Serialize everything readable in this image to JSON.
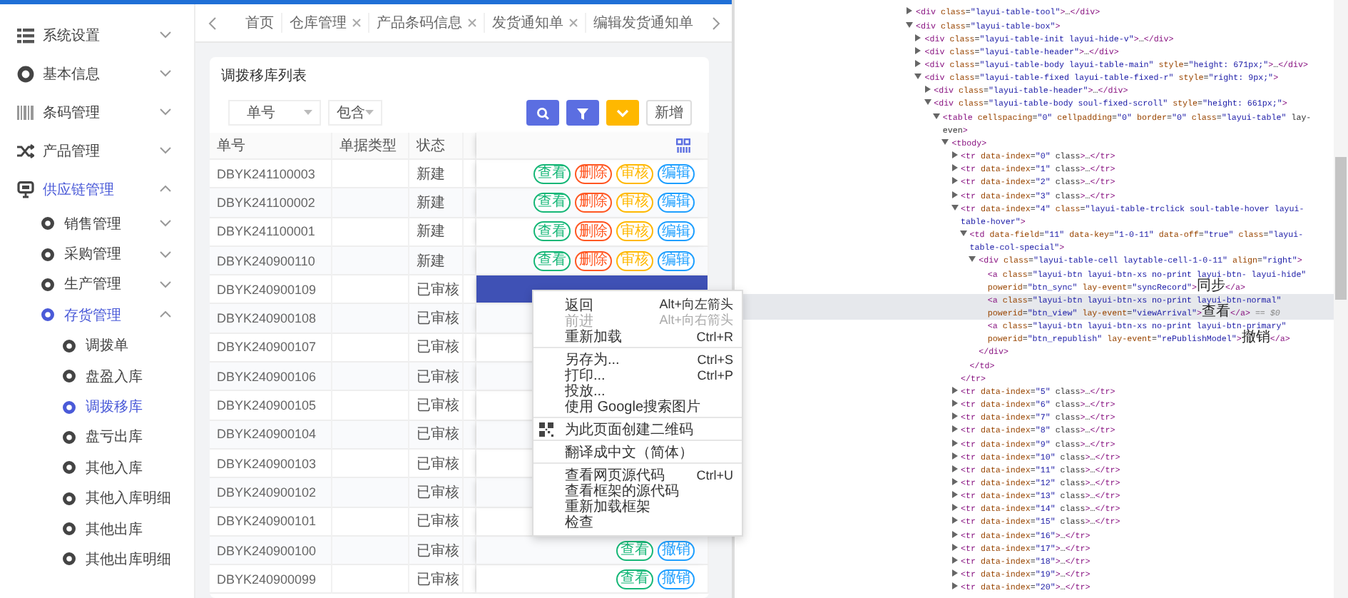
{
  "sidebar": {
    "items": [
      {
        "label": "系统设置",
        "expanded": false,
        "selected": false
      },
      {
        "label": "基本信息",
        "expanded": false,
        "selected": false
      },
      {
        "label": "条码管理",
        "expanded": false,
        "selected": false
      },
      {
        "label": "产品管理",
        "expanded": false,
        "selected": false
      },
      {
        "label": "供应链管理",
        "expanded": true,
        "selected": true,
        "children": [
          {
            "label": "销售管理",
            "expanded": false,
            "selected": false
          },
          {
            "label": "采购管理",
            "expanded": false,
            "selected": false
          },
          {
            "label": "生产管理",
            "expanded": false,
            "selected": false
          },
          {
            "label": "存货管理",
            "expanded": true,
            "selected": true,
            "children": [
              {
                "label": "调拨单",
                "selected": false
              },
              {
                "label": "盘盈入库",
                "selected": false
              },
              {
                "label": "调拨移库",
                "selected": true
              },
              {
                "label": "盘亏出库",
                "selected": false
              },
              {
                "label": "其他入库",
                "selected": false
              },
              {
                "label": "其他入库明细",
                "selected": false
              },
              {
                "label": "其他出库",
                "selected": false
              },
              {
                "label": "其他出库明细",
                "selected": false
              }
            ]
          }
        ]
      }
    ]
  },
  "tabs": [
    {
      "label": "首页",
      "closable": false
    },
    {
      "label": "仓库管理",
      "closable": true
    },
    {
      "label": "产品条码信息",
      "closable": true
    },
    {
      "label": "发货通知单",
      "closable": true
    },
    {
      "label": "编辑发货通知单",
      "closable": false
    }
  ],
  "panel": {
    "title": "调拨移库列表",
    "filters": [
      {
        "value": "单号"
      },
      {
        "value": "包含"
      }
    ],
    "buttons": [
      {
        "kind": "search"
      },
      {
        "kind": "filter"
      },
      {
        "kind": "expand"
      },
      {
        "kind": "text",
        "label": "新增"
      }
    ]
  },
  "table": {
    "columns": [
      "单号",
      "单据类型",
      "状态"
    ],
    "rows": [
      {
        "number": "DBYK241100003",
        "status": "新建",
        "highlighted": false,
        "actions": [
          {
            "label": "查看",
            "color": "#16b777"
          },
          {
            "label": "删除",
            "color": "#ff5722"
          },
          {
            "label": "审核",
            "color": "#ffb800"
          },
          {
            "label": "编辑",
            "color": "#1e9fff"
          }
        ]
      },
      {
        "number": "DBYK241100002",
        "status": "新建",
        "highlighted": false,
        "actions": [
          {
            "label": "查看",
            "color": "#16b777"
          },
          {
            "label": "删除",
            "color": "#ff5722"
          },
          {
            "label": "审核",
            "color": "#ffb800"
          },
          {
            "label": "编辑",
            "color": "#1e9fff"
          }
        ]
      },
      {
        "number": "DBYK241100001",
        "status": "新建",
        "highlighted": false,
        "actions": [
          {
            "label": "查看",
            "color": "#16b777"
          },
          {
            "label": "删除",
            "color": "#ff5722"
          },
          {
            "label": "审核",
            "color": "#ffb800"
          },
          {
            "label": "编辑",
            "color": "#1e9fff"
          }
        ]
      },
      {
        "number": "DBYK240900110",
        "status": "新建",
        "highlighted": false,
        "actions": [
          {
            "label": "查看",
            "color": "#16b777"
          },
          {
            "label": "删除",
            "color": "#ff5722"
          },
          {
            "label": "审核",
            "color": "#ffb800"
          },
          {
            "label": "编辑",
            "color": "#1e9fff"
          }
        ]
      },
      {
        "number": "DBYK240900109",
        "status": "已审核",
        "highlighted": true
      },
      {
        "number": "DBYK240900108",
        "status": "已审核",
        "highlighted": false
      },
      {
        "number": "DBYK240900107",
        "status": "已审核",
        "highlighted": false
      },
      {
        "number": "DBYK240900106",
        "status": "已审核",
        "highlighted": false
      },
      {
        "number": "DBYK240900105",
        "status": "已审核",
        "highlighted": false
      },
      {
        "number": "DBYK240900104",
        "status": "已审核",
        "highlighted": false
      },
      {
        "number": "DBYK240900103",
        "status": "已审核",
        "highlighted": false
      },
      {
        "number": "DBYK240900102",
        "status": "已审核",
        "highlighted": false
      },
      {
        "number": "DBYK240900101",
        "status": "已审核",
        "highlighted": false
      },
      {
        "number": "DBYK240900100",
        "status": "已审核",
        "highlighted": false,
        "actions": [
          {
            "label": "查看",
            "color": "#16b777"
          },
          {
            "label": "撤销",
            "color": "#1e9fff"
          }
        ]
      },
      {
        "number": "DBYK240900099",
        "status": "已审核",
        "highlighted": false,
        "actions": [
          {
            "label": "查看",
            "color": "#16b777"
          },
          {
            "label": "撤销",
            "color": "#1e9fff"
          }
        ]
      }
    ]
  },
  "context_menu": {
    "groups": [
      {
        "items": [
          {
            "kind": "plain",
            "label": "返回",
            "shortcut": "Alt+向左箭头",
            "disabled": false
          },
          {
            "kind": "plain",
            "label": "前进",
            "shortcut": "Alt+向右箭头",
            "disabled": true
          },
          {
            "kind": "plain",
            "label": "重新加载",
            "shortcut": "Ctrl+R",
            "disabled": false
          }
        ]
      },
      {
        "items": [
          {
            "kind": "plain",
            "label": "另存为...",
            "shortcut": "Ctrl+S",
            "disabled": false
          },
          {
            "kind": "plain",
            "label": "打印...",
            "shortcut": "Ctrl+P",
            "disabled": false
          },
          {
            "kind": "plain",
            "label": "投放...",
            "disabled": false
          },
          {
            "kind": "plain",
            "label": "使用 Google搜索图片",
            "disabled": false
          }
        ]
      },
      {
        "items": [
          {
            "kind": "icon",
            "label": "为此页面创建二维码",
            "disabled": false
          }
        ]
      },
      {
        "items": [
          {
            "kind": "plain",
            "label": "翻译成中文（简体）",
            "disabled": false
          }
        ]
      },
      {
        "items": [
          {
            "kind": "plain",
            "label": "查看网页源代码",
            "shortcut": "Ctrl+U",
            "disabled": false
          },
          {
            "kind": "plain",
            "label": "查看框架的源代码",
            "disabled": false
          },
          {
            "kind": "plain",
            "label": "重新加载框架",
            "disabled": false
          },
          {
            "kind": "plain",
            "label": "检查",
            "disabled": false
          }
        ]
      }
    ]
  },
  "devtools": {
    "nodes": [
      {
        "kind": "element",
        "markup": "<div class=\"layui-table-tool\">…</div>",
        "expanded": false,
        "selected": false
      },
      {
        "kind": "element",
        "markup": "<div class=\"layui-table-box\">",
        "expanded": true,
        "selected": false,
        "children": [
          {
            "kind": "element",
            "markup": "<div class=\"layui-table-init layui-hide-v\">…</div>",
            "expanded": false,
            "selected": false
          },
          {
            "kind": "element",
            "markup": "<div class=\"layui-table-header\">…</div>",
            "expanded": false,
            "selected": false
          },
          {
            "kind": "element",
            "markup": "<div class=\"layui-table-body layui-table-main\" style=\"height: 671px;\">…</div>",
            "expanded": false,
            "selected": false
          },
          {
            "kind": "element",
            "markup": "<div class=\"layui-table-fixed layui-table-fixed-r\" style=\"right: 9px;\">",
            "expanded": true,
            "selected": false,
            "children": [
              {
                "kind": "element",
                "markup": "<div class=\"layui-table-header\">…</div>",
                "expanded": false,
                "selected": false
              },
              {
                "kind": "element",
                "markup": "<div class=\"layui-table-body soul-fixed-scroll\" style=\"height: 661px;\">",
                "expanded": true,
                "selected": false,
                "children": [
                  {
                    "kind": "element",
                    "markup": "<table cellspacing=\"0\" cellpadding=\"0\" border=\"0\" class=\"layui-table\" lay-even>",
                    "expanded": true,
                    "selected": false,
                    "children": [
                      {
                        "kind": "element",
                        "markup": "<tbody>",
                        "expanded": true,
                        "selected": false,
                        "children": [
                          {
                            "kind": "element",
                            "markup": "<tr data-index=\"0\" class>…</tr>",
                            "expanded": false,
                            "selected": false
                          },
                          {
                            "kind": "element",
                            "markup": "<tr data-index=\"1\" class>…</tr>",
                            "expanded": false,
                            "selected": false
                          },
                          {
                            "kind": "element",
                            "markup": "<tr data-index=\"2\" class>…</tr>",
                            "expanded": false,
                            "selected": false
                          },
                          {
                            "kind": "element",
                            "markup": "<tr data-index=\"3\" class>…</tr>",
                            "expanded": false,
                            "selected": false
                          },
                          {
                            "kind": "element",
                            "markup": "<tr data-index=\"4\" class=\"layui-table-trclick soul-table-hover layui-table-hover\">",
                            "expanded": true,
                            "selected": false,
                            "close": "</tr>",
                            "children": [
                              {
                                "kind": "element",
                                "markup": "<td data-field=\"11\" data-key=\"1-0-11\" data-off=\"true\" class=\"layui-table-col-special\">",
                                "expanded": true,
                                "selected": false,
                                "close": "</td>",
                                "children": [
                                  {
                                    "kind": "element",
                                    "markup": "<div class=\"layui-table-cell laytable-cell-1-0-11\" align=\"right\">",
                                    "expanded": true,
                                    "selected": false,
                                    "close": "</div>",
                                    "children": [
                                      {
                                        "kind": "leaf",
                                        "markup": "<a class=\"layui-btn layui-btn-xs no-print layui-btn- layui-hide\" powerid=\"btn_sync\" lay-event=\"syncRecord\">同步</a>",
                                        "selected": false
                                      },
                                      {
                                        "kind": "leaf",
                                        "markup": "<a class=\"layui-btn layui-btn-xs no-print layui-btn-normal\" powerid=\"btn_view\" lay-event=\"viewArrival\">查看</a>",
                                        "selected": true,
                                        "marker": "== $0"
                                      },
                                      {
                                        "kind": "leaf",
                                        "markup": "<a class=\"layui-btn layui-btn-xs no-print layui-btn-primary\" powerid=\"btn_republish\" lay-event=\"rePublishModel\">撤销</a>",
                                        "selected": false
                                      }
                                    ]
                                  }
                                ]
                              }
                            ]
                          },
                          {
                            "kind": "element",
                            "markup": "<tr data-index=\"5\" class>…</tr>",
                            "expanded": false,
                            "selected": false
                          },
                          {
                            "kind": "element",
                            "markup": "<tr data-index=\"6\" class>…</tr>",
                            "expanded": false,
                            "selected": false
                          },
                          {
                            "kind": "element",
                            "markup": "<tr data-index=\"7\" class>…</tr>",
                            "expanded": false,
                            "selected": false
                          },
                          {
                            "kind": "element",
                            "markup": "<tr data-index=\"8\" class>…</tr>",
                            "expanded": false,
                            "selected": false
                          },
                          {
                            "kind": "element",
                            "markup": "<tr data-index=\"9\" class>…</tr>",
                            "expanded": false,
                            "selected": false
                          },
                          {
                            "kind": "element",
                            "markup": "<tr data-index=\"10\" class>…</tr>",
                            "expanded": false,
                            "selected": false
                          },
                          {
                            "kind": "element",
                            "markup": "<tr data-index=\"11\" class>…</tr>",
                            "expanded": false,
                            "selected": false
                          },
                          {
                            "kind": "element",
                            "markup": "<tr data-index=\"12\" class>…</tr>",
                            "expanded": false,
                            "selected": false
                          },
                          {
                            "kind": "element",
                            "markup": "<tr data-index=\"13\" class>…</tr>",
                            "expanded": false,
                            "selected": false
                          },
                          {
                            "kind": "element",
                            "markup": "<tr data-index=\"14\" class>…</tr>",
                            "expanded": false,
                            "selected": false
                          },
                          {
                            "kind": "element",
                            "markup": "<tr data-index=\"15\" class>…</tr>",
                            "expanded": false,
                            "selected": false
                          },
                          {
                            "kind": "element",
                            "markup": "<tr data-index=\"16\">…</tr>",
                            "expanded": false,
                            "selected": false
                          },
                          {
                            "kind": "element",
                            "markup": "<tr data-index=\"17\">…</tr>",
                            "expanded": false,
                            "selected": false
                          },
                          {
                            "kind": "element",
                            "markup": "<tr data-index=\"18\">…</tr>",
                            "expanded": false,
                            "selected": false
                          },
                          {
                            "kind": "element",
                            "markup": "<tr data-index=\"19\">…</tr>",
                            "expanded": false,
                            "selected": false
                          },
                          {
                            "kind": "element",
                            "markup": "<tr data-index=\"20\">…</tr>",
                            "expanded": false,
                            "selected": false
                          }
                        ]
                      }
                    ]
                  }
                ]
              }
            ]
          }
        ]
      }
    ]
  }
}
